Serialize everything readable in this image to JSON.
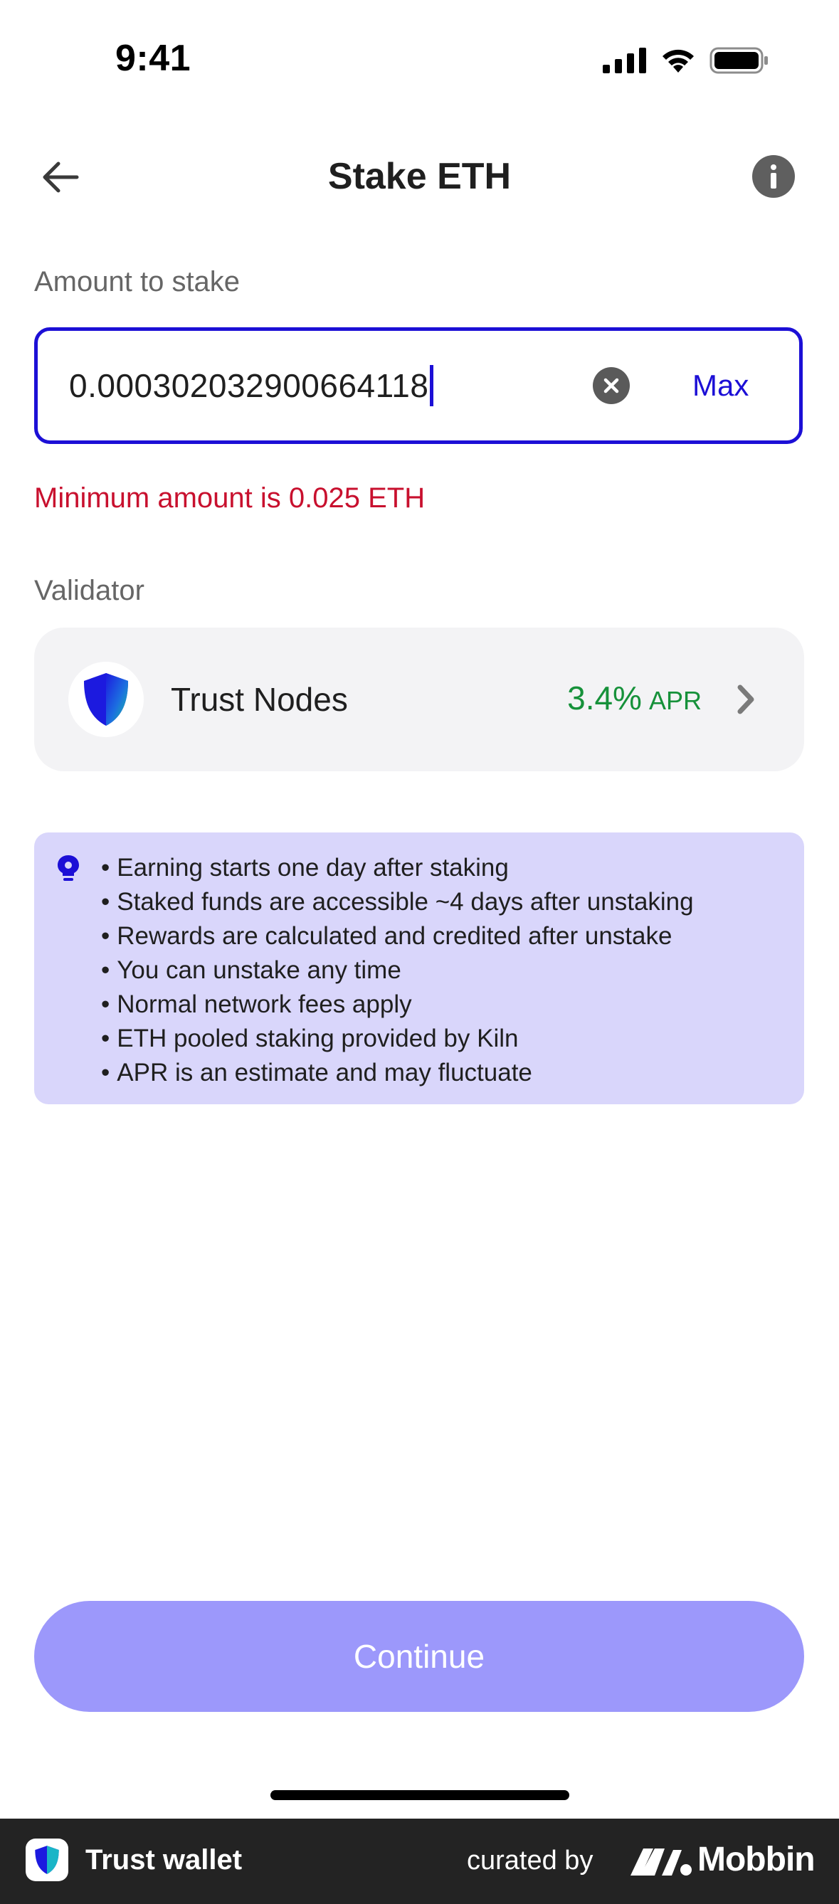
{
  "status_bar": {
    "time": "9:41",
    "icons": [
      "signal-icon",
      "wifi-icon",
      "battery-icon"
    ]
  },
  "header": {
    "title": "Stake ETH",
    "back_icon": "arrow-left-icon",
    "info_icon": "info-icon"
  },
  "amount": {
    "label": "Amount to stake",
    "value": "0.000302032900664118",
    "clear_icon": "clear-icon",
    "max_label": "Max",
    "error": "Minimum amount is 0.025 ETH"
  },
  "validator": {
    "label": "Validator",
    "name": "Trust Nodes",
    "apr_value": "3.4%",
    "apr_unit": "APR",
    "icon": "shield-icon"
  },
  "info_box": {
    "icon": "lightbulb-icon",
    "items": [
      "Earning starts one day after staking",
      "Staked funds are accessible ~4 days after unstaking",
      "Rewards are calculated and credited after unstake",
      "You can unstake any time",
      "Normal network fees apply",
      "ETH pooled staking provided by Kiln",
      "APR is an estimate and may fluctuate"
    ]
  },
  "continue_label": "Continue",
  "footer": {
    "brand": "Trust wallet",
    "curated": "curated by",
    "mobbin": "Mobbin"
  },
  "colors": {
    "accent": "#1c0fd6",
    "error": "#c8102e",
    "apr_green": "#16913a",
    "info_bg": "#d9d6fb",
    "button_disabled": "#9c98fb"
  }
}
